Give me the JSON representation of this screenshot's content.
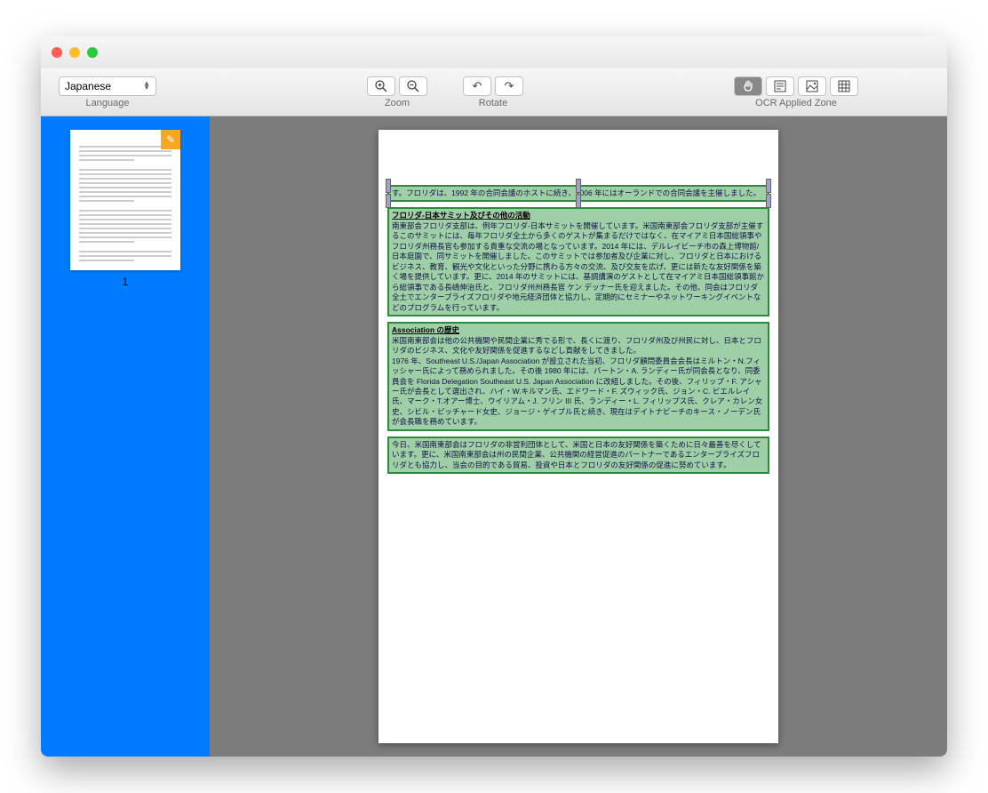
{
  "toolbar": {
    "language": {
      "label": "Language",
      "value": "Japanese"
    },
    "zoom": {
      "label": "Zoom"
    },
    "rotate": {
      "label": "Rotate"
    },
    "ocr_zone": {
      "label": "OCR Applied Zone"
    }
  },
  "sidebar": {
    "page_number": "1"
  },
  "zones": [
    {
      "selected": true,
      "title": "",
      "text": "す。フロリダは、1992 年の合同会議のホストに続き、2006 年にはオーランドでの合同会議を主催しました。"
    },
    {
      "selected": false,
      "title": "フロリダ-日本サミット及びその他の活動",
      "text": "南東部会フロリダ支部は、例年フロリダ-日本サミットを開催しています。米国南東部会フロリダ支部が主催するこのサミットには、毎年フロリダ全土から多くのゲストが集まるだけではなく、在マイアミ日本国総領事やフロリダ州務長官も参加する貴重な交流の場となっています。2014 年には、デルレイビーチ市の森上博物館/日本庭園で、同サミットを開催しました。このサミットでは参加者及び企業に対し、フロリダと日本におけるビジネス、教育、観光や文化といった分野に携わる方々の交流、及び交友を広げ、更には新たな友好関係を築く場を提供しています。更に、2014 年のサミットには、基調講演のゲストとして在マイアミ日本国総領事館から総領事である長嶋伸治氏と、フロリダ州州務長官 ケン デッナー氏を迎えました。その他、同会はフロリダ全土でエンタープライズフロリダや地元経済団体と協力し、定期的にセミナーやネットワーキングイベントなどのプログラムを行っています。"
    },
    {
      "selected": false,
      "title": "Association の歴史",
      "text": "米国南東部会は他の公共機関や民間企業に秀でる形で、長くに渡り、フロリダ州及び州民に対し、日本とフロリダのビジネス、文化や友好関係を促進するなどし貢献をしてきました。\n1976 年、Southeast U.S./Japan Association が設立された当初、フロリダ顧問委員会会長はミルトン・N.フィッシャー氏によって務められました。その後 1980 年には、バートン・A. ランディー氏が同会長となり、同委員会を Florida Delegation Southeast U.S. Japan Association に改組しました。その後、フィリップ・F. アシャー氏が会長として選出され、ハイ・W.キルマン氏、エドワード・F. ズウィック氏、ジョン・C. ビエルレイ氏、マーク・T.オアー博士、ウイリアム・J. フリン III 氏、ランディー・L. フィリップス氏、クレア・カレン女史、シビル・ピッチャード女史、ジョージ・ゲイブル氏と続き、現在はデイトナビーチのキース・ノーデン氏が会長職を務めています。"
    },
    {
      "selected": false,
      "title": "",
      "text": "今日、米国南東部会はフロリダの非営利団体として、米国と日本の友好関係を築くために日々最善を尽くしています。更に、米国南東部会は州の民間企業、公共機関の経営促進のパートナーであるエンタープライズフロリダとも協力し、当会の目的である貿易、投資や日本とフロリダの友好関係の促進に努めています。"
    }
  ]
}
